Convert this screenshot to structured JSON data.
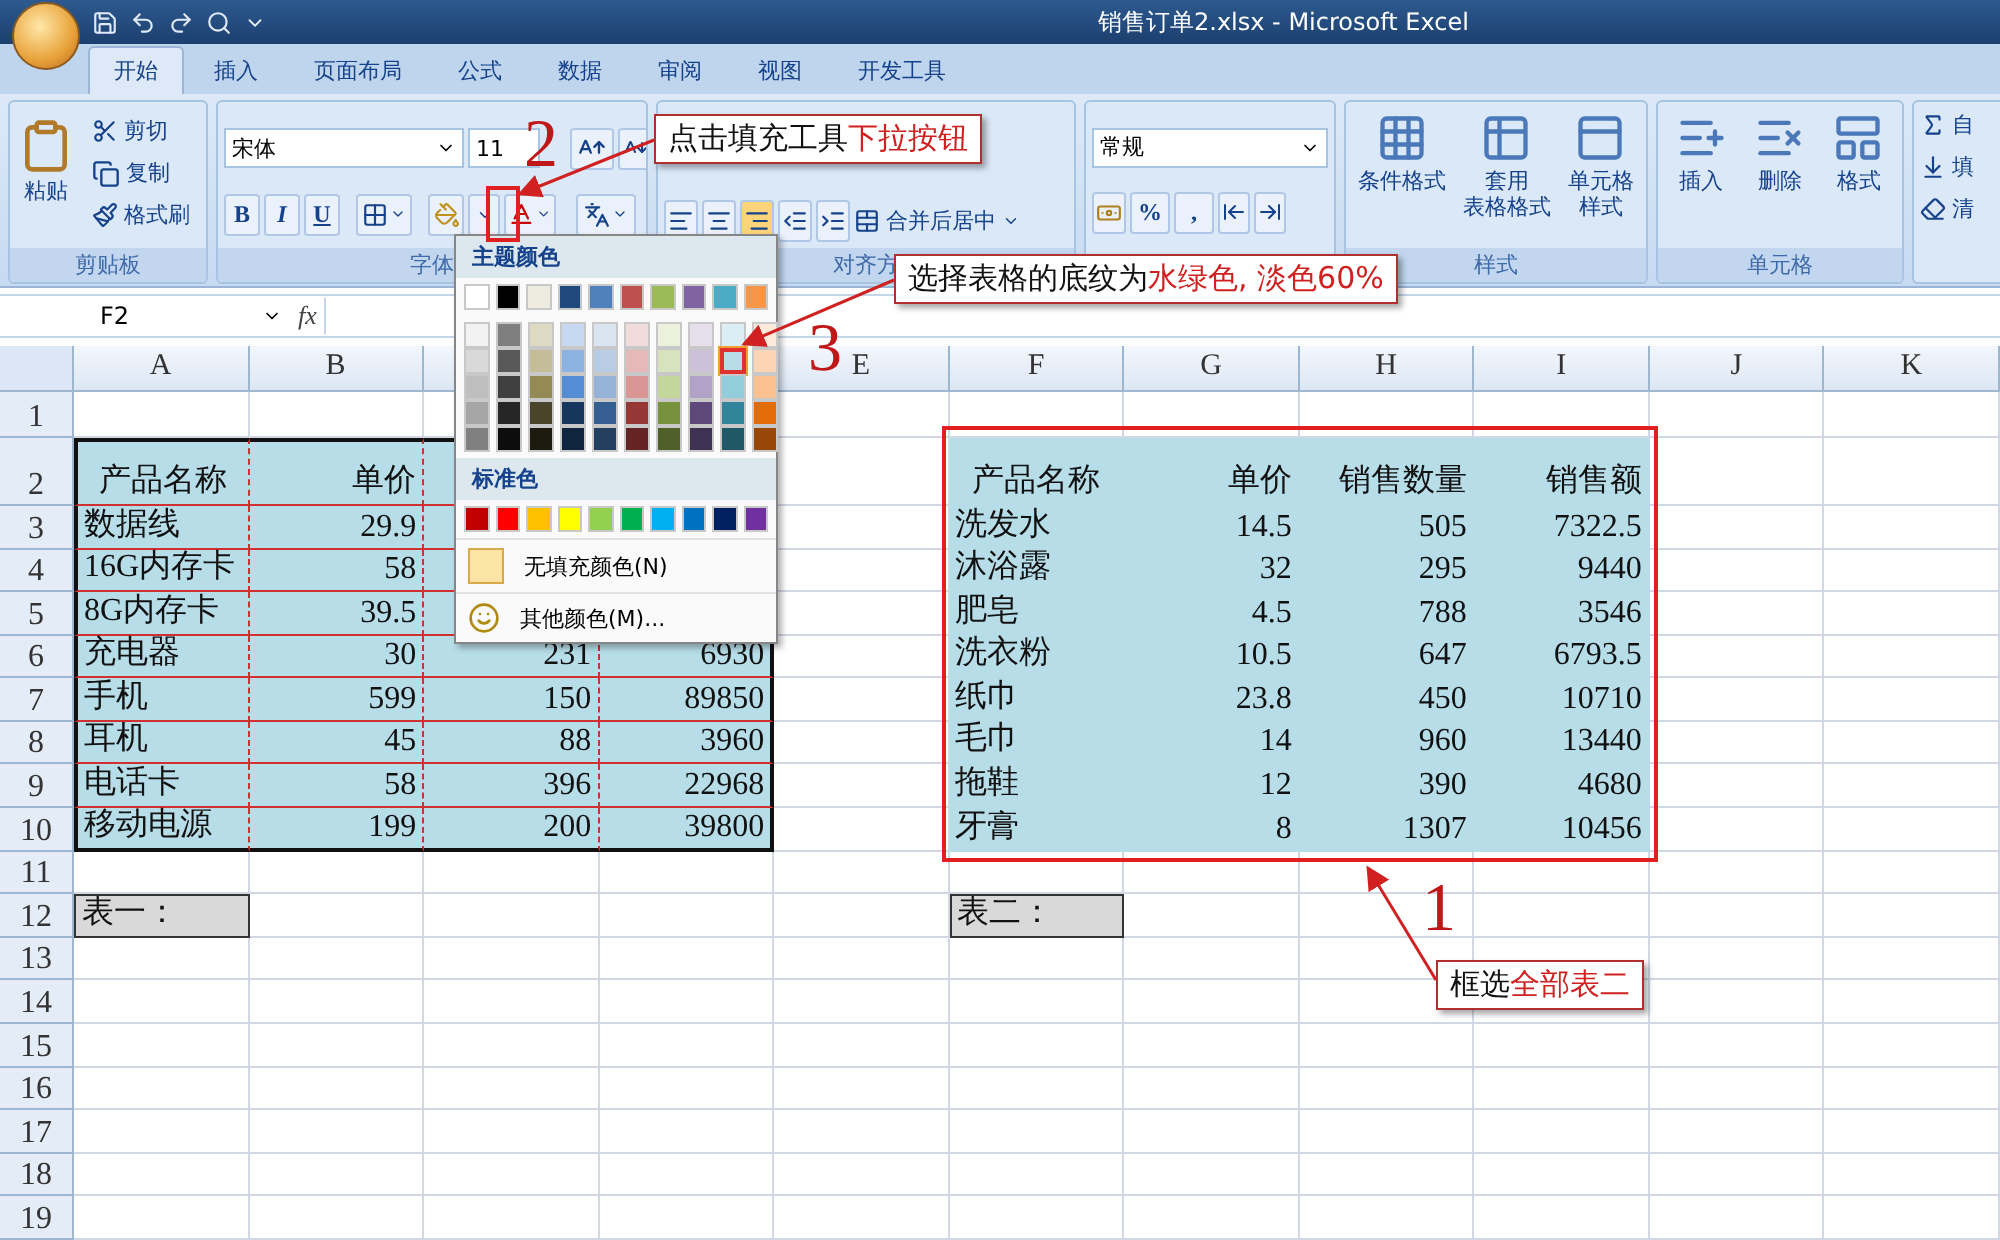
{
  "window": {
    "title": "销售订单2.xlsx - Microsoft Excel"
  },
  "tabs": [
    {
      "label": "开始",
      "selected": true
    },
    {
      "label": "插入",
      "selected": false
    },
    {
      "label": "页面布局",
      "selected": false
    },
    {
      "label": "公式",
      "selected": false
    },
    {
      "label": "数据",
      "selected": false
    },
    {
      "label": "审阅",
      "selected": false
    },
    {
      "label": "视图",
      "selected": false
    },
    {
      "label": "开发工具",
      "selected": false
    }
  ],
  "ribbon": {
    "clipboard": {
      "paste": "粘贴",
      "cut": "剪切",
      "copy": "复制",
      "format_painter": "格式刷",
      "group": "剪贴板"
    },
    "font": {
      "name": "宋体",
      "size": "11",
      "style_buttons": [
        "B",
        "I",
        "U"
      ],
      "group": "字体"
    },
    "alignment": {
      "merge": "合并后居中",
      "group": "对齐方"
    },
    "number": {
      "format": "常规",
      "buttons": [
        "%",
        ","
      ]
    },
    "styles": {
      "items": [
        {
          "lines": [
            "条件格式"
          ]
        },
        {
          "lines": [
            "套用",
            "表格格式"
          ]
        },
        {
          "lines": [
            "单元格",
            "样式"
          ]
        }
      ],
      "group": "样式"
    },
    "cells": {
      "items": [
        "插入",
        "删除",
        "格式"
      ],
      "group": "单元格"
    },
    "editing": {
      "items": [
        "自",
        "填",
        "清"
      ]
    }
  },
  "formula_bar": {
    "name_box": "F2",
    "function_label": "fx"
  },
  "fill_menu": {
    "theme_title": "主题颜色",
    "theme_columns": [
      [
        {
          "color": "#ffffff",
          "selected": false
        },
        {
          "color": "#f2f2f2",
          "selected": false
        },
        {
          "color": "#d9d9d9",
          "selected": false
        },
        {
          "color": "#bfbfbf",
          "selected": false
        },
        {
          "color": "#a6a6a6",
          "selected": false
        },
        {
          "color": "#808080",
          "selected": false
        }
      ],
      [
        {
          "color": "#000000",
          "selected": false
        },
        {
          "color": "#7f7f7f",
          "selected": false
        },
        {
          "color": "#595959",
          "selected": false
        },
        {
          "color": "#3f3f3f",
          "selected": false
        },
        {
          "color": "#262626",
          "selected": false
        },
        {
          "color": "#0d0d0d",
          "selected": false
        }
      ],
      [
        {
          "color": "#eeece1",
          "selected": false
        },
        {
          "color": "#ddd9c3",
          "selected": false
        },
        {
          "color": "#c4bd97",
          "selected": false
        },
        {
          "color": "#948a54",
          "selected": false
        },
        {
          "color": "#4a452a",
          "selected": false
        },
        {
          "color": "#1d1b10",
          "selected": false
        }
      ],
      [
        {
          "color": "#1f497d",
          "selected": false
        },
        {
          "color": "#c6d9f0",
          "selected": false
        },
        {
          "color": "#8db3e2",
          "selected": false
        },
        {
          "color": "#548dd4",
          "selected": false
        },
        {
          "color": "#17365d",
          "selected": false
        },
        {
          "color": "#0f243e",
          "selected": false
        }
      ],
      [
        {
          "color": "#4f81bd",
          "selected": false
        },
        {
          "color": "#dbe5f1",
          "selected": false
        },
        {
          "color": "#b8cce4",
          "selected": false
        },
        {
          "color": "#95b3d7",
          "selected": false
        },
        {
          "color": "#366092",
          "selected": false
        },
        {
          "color": "#244061",
          "selected": false
        }
      ],
      [
        {
          "color": "#c0504d",
          "selected": false
        },
        {
          "color": "#f2dcdb",
          "selected": false
        },
        {
          "color": "#e5b9b7",
          "selected": false
        },
        {
          "color": "#d99694",
          "selected": false
        },
        {
          "color": "#953734",
          "selected": false
        },
        {
          "color": "#632423",
          "selected": false
        }
      ],
      [
        {
          "color": "#9bbb59",
          "selected": false
        },
        {
          "color": "#ebf1dd",
          "selected": false
        },
        {
          "color": "#d7e3bc",
          "selected": false
        },
        {
          "color": "#c3d69b",
          "selected": false
        },
        {
          "color": "#76923c",
          "selected": false
        },
        {
          "color": "#4f6128",
          "selected": false
        }
      ],
      [
        {
          "color": "#8064a2",
          "selected": false
        },
        {
          "color": "#e5e0ec",
          "selected": false
        },
        {
          "color": "#ccc1d9",
          "selected": false
        },
        {
          "color": "#b2a2c7",
          "selected": false
        },
        {
          "color": "#5f497a",
          "selected": false
        },
        {
          "color": "#3f3151",
          "selected": false
        }
      ],
      [
        {
          "color": "#4bacc6",
          "selected": false
        },
        {
          "color": "#dbeef3",
          "selected": false
        },
        {
          "color": "#b7dde8",
          "selected": true
        },
        {
          "color": "#92cddc",
          "selected": false
        },
        {
          "color": "#31859b",
          "selected": false
        },
        {
          "color": "#205867",
          "selected": false
        }
      ],
      [
        {
          "color": "#f79646",
          "selected": false
        },
        {
          "color": "#fdeada",
          "selected": false
        },
        {
          "color": "#fbd5b5",
          "selected": false
        },
        {
          "color": "#fac08f",
          "selected": false
        },
        {
          "color": "#e36c09",
          "selected": false
        },
        {
          "color": "#974806",
          "selected": false
        }
      ]
    ],
    "standard_title": "标准色",
    "standard_colors": [
      {
        "color": "#c00000",
        "selected": false
      },
      {
        "color": "#ff0000",
        "selected": false
      },
      {
        "color": "#ffc000",
        "selected": false
      },
      {
        "color": "#ffff00",
        "selected": false
      },
      {
        "color": "#92d050",
        "selected": false
      },
      {
        "color": "#00b050",
        "selected": false
      },
      {
        "color": "#00b0f0",
        "selected": false
      },
      {
        "color": "#0070c0",
        "selected": false
      },
      {
        "color": "#002060",
        "selected": false
      },
      {
        "color": "#7030a0",
        "selected": false
      }
    ],
    "no_fill": "无填充颜色(N)",
    "more_colors": "其他颜色(M)..."
  },
  "sheet": {
    "columns_left": [
      "A",
      "B"
    ],
    "columns_right": [
      "E",
      "F",
      "G",
      "H",
      "I",
      "J",
      "K"
    ],
    "row_numbers": [
      "1",
      "2",
      "3",
      "4",
      "5",
      "6",
      "7",
      "8",
      "9",
      "10",
      "11",
      "12",
      "13",
      "14",
      "15",
      "16",
      "17",
      "18",
      "19"
    ],
    "table_one": {
      "header": [
        "产品名称",
        "单价"
      ],
      "rows": [
        [
          "数据线",
          "29.9"
        ],
        [
          "16G内存卡",
          "58"
        ],
        [
          "8G内存卡",
          "39.5"
        ],
        [
          "充电器",
          "30",
          "231",
          "6930"
        ],
        [
          "手机",
          "599",
          "150",
          "89850"
        ],
        [
          "耳机",
          "45",
          "88",
          "3960"
        ],
        [
          "电话卡",
          "58",
          "396",
          "22968"
        ],
        [
          "移动电源",
          "199",
          "200",
          "39800"
        ]
      ],
      "label": "表一："
    },
    "table_two": {
      "header": [
        "产品名称",
        "单价",
        "销售数量",
        "销售额"
      ],
      "rows": [
        [
          "洗发水",
          "14.5",
          "505",
          "7322.5"
        ],
        [
          "沐浴露",
          "32",
          "295",
          "9440"
        ],
        [
          "肥皂",
          "4.5",
          "788",
          "3546"
        ],
        [
          "洗衣粉",
          "10.5",
          "647",
          "6793.5"
        ],
        [
          "纸巾",
          "23.8",
          "450",
          "10710"
        ],
        [
          "毛巾",
          "14",
          "960",
          "13440"
        ],
        [
          "拖鞋",
          "12",
          "390",
          "4680"
        ],
        [
          "牙膏",
          "8",
          "1307",
          "10456"
        ]
      ],
      "label": "表二："
    }
  },
  "annotations": [
    {
      "step": "2",
      "text": "点击填充工具",
      "highlight": "下拉按钮"
    },
    {
      "step": "3",
      "text": "选择表格的底纹为",
      "highlight": "水绿色, 淡色60%"
    },
    {
      "step": "1",
      "text": "框选",
      "highlight": "全部表二"
    }
  ]
}
